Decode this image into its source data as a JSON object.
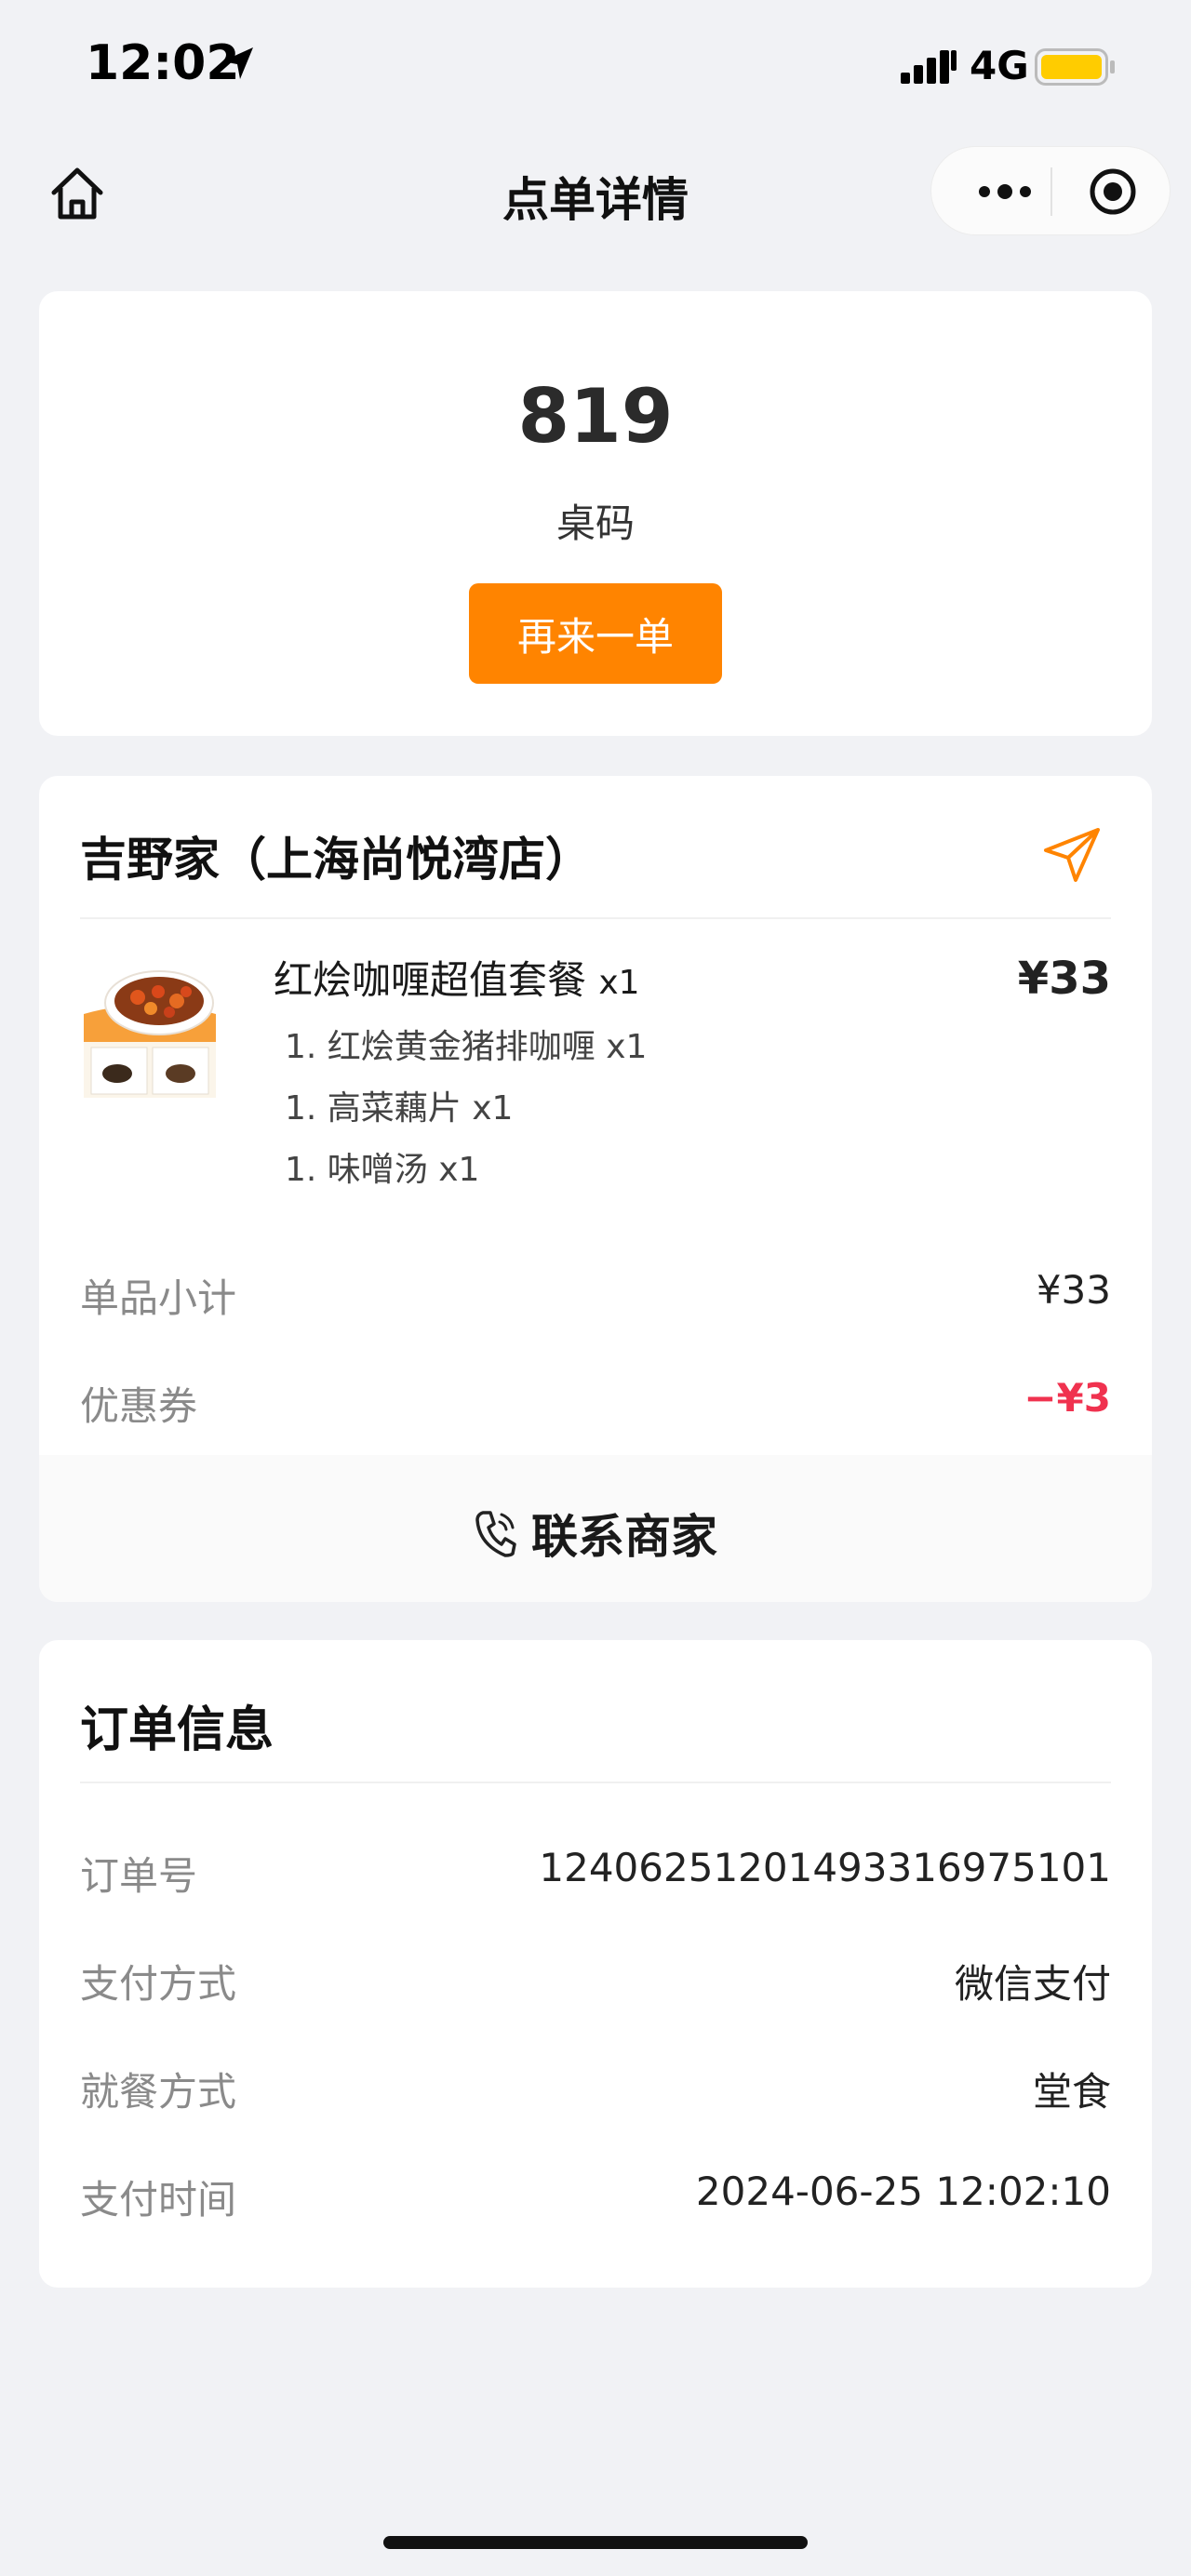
{
  "status_bar": {
    "time": "12:02",
    "network": "4G",
    "battery_color": "#ffcc00"
  },
  "nav": {
    "title": "点单详情",
    "icons": [
      "home-icon",
      "more-icon",
      "close-target-icon"
    ]
  },
  "table_card": {
    "number": "819",
    "label": "桌码",
    "reorder_label": "再来一单",
    "accent": "#ff8400"
  },
  "order_card": {
    "store_name": "吉野家（上海尚悦湾店）",
    "dish": {
      "name": "红烩咖喱超值套餐",
      "qty": "x1",
      "price": "¥33",
      "sub_items": [
        "1. 红烩黄金猪排咖喱 x1",
        "1. 高菜藕片 x1",
        "1. 味噌汤 x1"
      ]
    },
    "subtotal_label": "单品小计",
    "subtotal_value": "¥33",
    "coupon_label": "优惠券",
    "coupon_value": "−¥3",
    "coupon_color": "#f0324f",
    "contact_label": "联系商家"
  },
  "info_card": {
    "title": "订单信息",
    "rows": [
      {
        "label": "订单号",
        "value": "1240625120149331697510​1"
      },
      {
        "label": "支付方式",
        "value": "微信支付"
      },
      {
        "label": "就餐方式",
        "value": "堂食"
      },
      {
        "label": "支付时间",
        "value": "2024-06-25 12:02:10"
      }
    ]
  }
}
